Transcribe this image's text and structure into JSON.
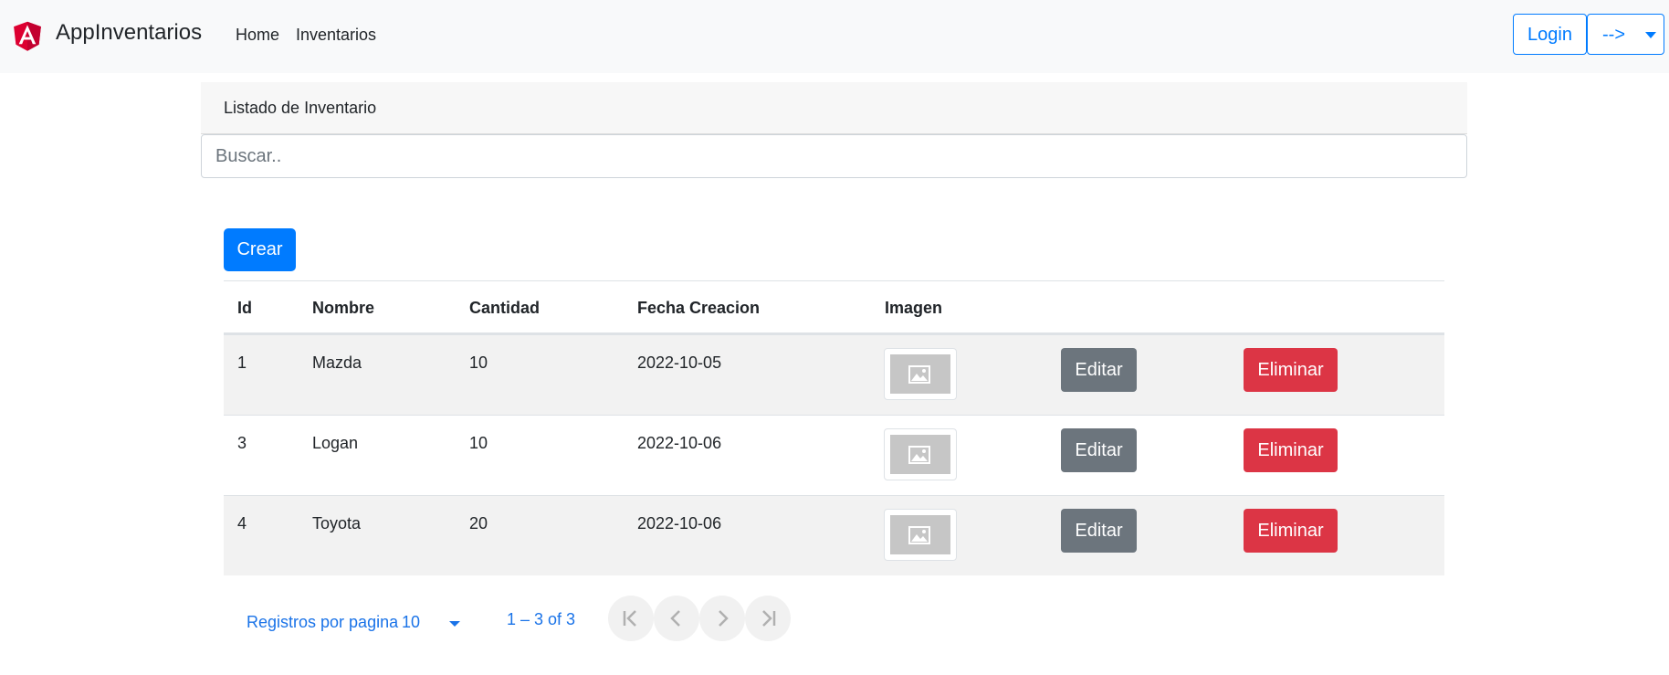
{
  "navbar": {
    "brand": "AppInventarios",
    "links": [
      {
        "label": "Home"
      },
      {
        "label": "Inventarios"
      }
    ],
    "login_label": "Login",
    "dropdown_label": "-->"
  },
  "card": {
    "header": "Listado de Inventario",
    "search_placeholder": "Buscar.."
  },
  "crear_label": "Crear",
  "table": {
    "headers": [
      "Id",
      "Nombre",
      "Cantidad",
      "Fecha Creacion",
      "Imagen"
    ],
    "rows": [
      {
        "id": "1",
        "nombre": "Mazda",
        "cantidad": "10",
        "fecha": "2022-10-05",
        "editar": "Editar",
        "eliminar": "Eliminar"
      },
      {
        "id": "3",
        "nombre": "Logan",
        "cantidad": "10",
        "fecha": "2022-10-06",
        "editar": "Editar",
        "eliminar": "Eliminar"
      },
      {
        "id": "4",
        "nombre": "Toyota",
        "cantidad": "20",
        "fecha": "2022-10-06",
        "editar": "Editar",
        "eliminar": "Eliminar"
      }
    ]
  },
  "paginator": {
    "per_page_label": "Registros por pagina",
    "per_page_value": "10",
    "range": "1 – 3 of 3"
  },
  "colors": {
    "primary": "#007bff",
    "secondary": "#6c757d",
    "danger": "#dc3545",
    "angular_red": "#dd0031"
  }
}
